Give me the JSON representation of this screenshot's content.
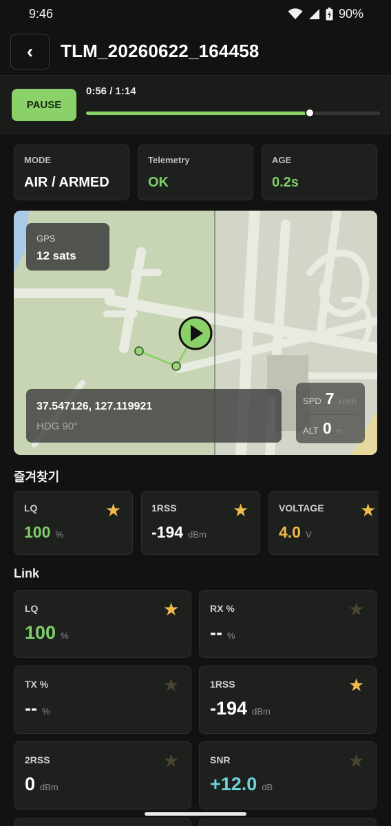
{
  "status_bar": {
    "time": "9:46",
    "battery": "90%"
  },
  "header": {
    "back_icon": "chevron-left-icon",
    "back_glyph": "‹",
    "title": "TLM_20260622_164458"
  },
  "playback": {
    "pause_label": "PAUSE",
    "time": "0:56 / 1:14",
    "progress": 0.76
  },
  "info": [
    {
      "label": "MODE",
      "value": "AIR / ARMED",
      "color": "#ffffff"
    },
    {
      "label": "Telemetry",
      "value": "OK",
      "color": "#7fcf6a"
    },
    {
      "label": "AGE",
      "value": "0.2s",
      "color": "#7fcf6a"
    }
  ],
  "map": {
    "gps_label": "GPS",
    "gps_value": "12 sats",
    "coords": "37.547126, 127.119921",
    "heading": "HDG 90°",
    "spd_label": "SPD",
    "spd_value": "7",
    "spd_unit": "km/h",
    "alt_label": "ALT",
    "alt_value": "0",
    "alt_unit": "m"
  },
  "favorites": {
    "title": "즐겨찾기",
    "items": [
      {
        "label": "LQ",
        "value": "100",
        "unit": "%",
        "color": "#7fcf6a",
        "starred": true
      },
      {
        "label": "1RSS",
        "value": "-194",
        "unit": "dBm",
        "color": "#ffffff",
        "starred": true
      },
      {
        "label": "VOLTAGE",
        "value": "4.0",
        "unit": "V",
        "color": "#f0b94a",
        "starred": true
      }
    ]
  },
  "link": {
    "title": "Link",
    "items": [
      {
        "label": "LQ",
        "value": "100",
        "unit": "%",
        "color": "#7fcf6a",
        "starred": true
      },
      {
        "label": "RX %",
        "value": "--",
        "unit": "%",
        "color": "#ffffff",
        "starred": false
      },
      {
        "label": "TX %",
        "value": "--",
        "unit": "%",
        "color": "#ffffff",
        "starred": false
      },
      {
        "label": "1RSS",
        "value": "-194",
        "unit": "dBm",
        "color": "#ffffff",
        "starred": true
      },
      {
        "label": "2RSS",
        "value": "0",
        "unit": "dBm",
        "color": "#ffffff",
        "starred": false
      },
      {
        "label": "SNR",
        "value": "+12.0",
        "unit": "dB",
        "color": "#6fd0d8",
        "starred": false
      }
    ]
  },
  "colors": {
    "accent": "#8bd169",
    "star_on": "#f0b94a",
    "star_off": "#4c4530"
  }
}
